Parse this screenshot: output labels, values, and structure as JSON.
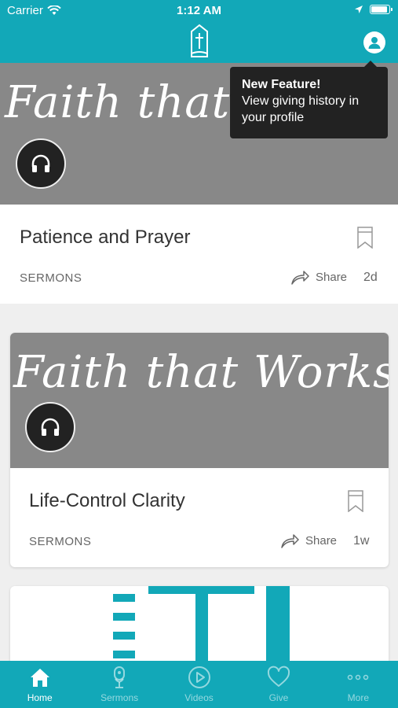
{
  "status_bar": {
    "carrier": "Carrier",
    "time": "1:12 AM"
  },
  "tooltip": {
    "title": "New Feature!",
    "body": "View giving history in your profile"
  },
  "cards": [
    {
      "banner_text": "Faith that Works",
      "title": "Patience and Prayer",
      "category": "SERMONS",
      "share_label": "Share",
      "age": "2d"
    },
    {
      "banner_text": "Faith that Works",
      "title": "Life-Control Clarity",
      "category": "SERMONS",
      "share_label": "Share",
      "age": "1w"
    }
  ],
  "tabs": [
    {
      "label": "Home",
      "icon": "home-icon",
      "active": true
    },
    {
      "label": "Sermons",
      "icon": "microphone-icon",
      "active": false
    },
    {
      "label": "Videos",
      "icon": "play-icon",
      "active": false
    },
    {
      "label": "Give",
      "icon": "heart-icon",
      "active": false
    },
    {
      "label": "More",
      "icon": "more-icon",
      "active": false
    }
  ],
  "colors": {
    "brand": "#12a8b8",
    "banner": "#888888",
    "tooltip": "#222222"
  }
}
